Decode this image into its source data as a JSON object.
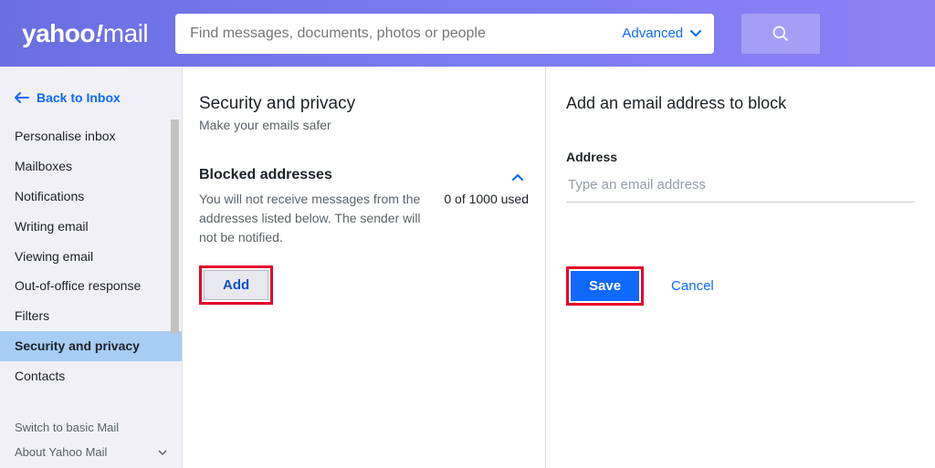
{
  "header": {
    "logo_main": "yahoo",
    "logo_exclaim": "!",
    "logo_mail": "mail",
    "search_placeholder": "Find messages, documents, photos or people",
    "advanced_label": "Advanced"
  },
  "sidebar": {
    "back_label": "Back to Inbox",
    "items": [
      {
        "label": "Personalise inbox"
      },
      {
        "label": "Mailboxes"
      },
      {
        "label": "Notifications"
      },
      {
        "label": "Writing email"
      },
      {
        "label": "Viewing email"
      },
      {
        "label": "Out-of-office response"
      },
      {
        "label": "Filters"
      },
      {
        "label": "Security and privacy"
      },
      {
        "label": "Contacts"
      }
    ],
    "active_index": 7,
    "bottom": [
      {
        "label": "Switch to basic Mail"
      },
      {
        "label": "About Yahoo Mail"
      }
    ]
  },
  "main": {
    "title": "Security and privacy",
    "subtitle": "Make your emails safer",
    "blocked": {
      "title": "Blocked addresses",
      "desc": "You will not receive messages from the addresses listed below. The sender will not be notified.",
      "count": "0 of 1000 used",
      "add_label": "Add"
    }
  },
  "form": {
    "title": "Add an email address to block",
    "field_label": "Address",
    "placeholder": "Type an email address",
    "save_label": "Save",
    "cancel_label": "Cancel"
  },
  "colors": {
    "accent": "#0f69ff",
    "highlight_border": "#e4002b",
    "sidebar_active": "#a7cdf5"
  }
}
